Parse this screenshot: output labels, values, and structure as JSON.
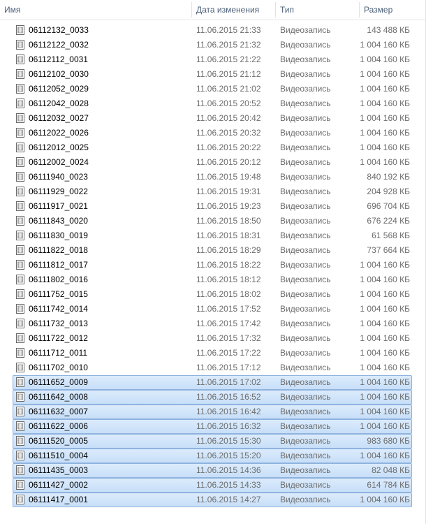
{
  "columns": {
    "name": "Имя",
    "date": "Дата изменения",
    "type": "Тип",
    "size": "Размер"
  },
  "icons": {
    "file": "video-file-icon"
  },
  "colors": {
    "header_text": "#4c607a",
    "selection_fill": "#cfe3fa",
    "selection_border": "#8fb3de",
    "secondary_text": "#6d6d6d"
  },
  "files": [
    {
      "name": "06112132_0033",
      "date": "11.06.2015 21:33",
      "type": "Видеозапись",
      "size": "143 488 КБ",
      "selected": false
    },
    {
      "name": "06112122_0032",
      "date": "11.06.2015 21:32",
      "type": "Видеозапись",
      "size": "1 004 160 КБ",
      "selected": false
    },
    {
      "name": "06112112_0031",
      "date": "11.06.2015 21:22",
      "type": "Видеозапись",
      "size": "1 004 160 КБ",
      "selected": false
    },
    {
      "name": "06112102_0030",
      "date": "11.06.2015 21:12",
      "type": "Видеозапись",
      "size": "1 004 160 КБ",
      "selected": false
    },
    {
      "name": "06112052_0029",
      "date": "11.06.2015 21:02",
      "type": "Видеозапись",
      "size": "1 004 160 КБ",
      "selected": false
    },
    {
      "name": "06112042_0028",
      "date": "11.06.2015 20:52",
      "type": "Видеозапись",
      "size": "1 004 160 КБ",
      "selected": false
    },
    {
      "name": "06112032_0027",
      "date": "11.06.2015 20:42",
      "type": "Видеозапись",
      "size": "1 004 160 КБ",
      "selected": false
    },
    {
      "name": "06112022_0026",
      "date": "11.06.2015 20:32",
      "type": "Видеозапись",
      "size": "1 004 160 КБ",
      "selected": false
    },
    {
      "name": "06112012_0025",
      "date": "11.06.2015 20:22",
      "type": "Видеозапись",
      "size": "1 004 160 КБ",
      "selected": false
    },
    {
      "name": "06112002_0024",
      "date": "11.06.2015 20:12",
      "type": "Видеозапись",
      "size": "1 004 160 КБ",
      "selected": false
    },
    {
      "name": "06111940_0023",
      "date": "11.06.2015 19:48",
      "type": "Видеозапись",
      "size": "840 192 КБ",
      "selected": false
    },
    {
      "name": "06111929_0022",
      "date": "11.06.2015 19:31",
      "type": "Видеозапись",
      "size": "204 928 КБ",
      "selected": false
    },
    {
      "name": "06111917_0021",
      "date": "11.06.2015 19:23",
      "type": "Видеозапись",
      "size": "696 704 КБ",
      "selected": false
    },
    {
      "name": "06111843_0020",
      "date": "11.06.2015 18:50",
      "type": "Видеозапись",
      "size": "676 224 КБ",
      "selected": false
    },
    {
      "name": "06111830_0019",
      "date": "11.06.2015 18:31",
      "type": "Видеозапись",
      "size": "61 568 КБ",
      "selected": false
    },
    {
      "name": "06111822_0018",
      "date": "11.06.2015 18:29",
      "type": "Видеозапись",
      "size": "737 664 КБ",
      "selected": false
    },
    {
      "name": "06111812_0017",
      "date": "11.06.2015 18:22",
      "type": "Видеозапись",
      "size": "1 004 160 КБ",
      "selected": false
    },
    {
      "name": "06111802_0016",
      "date": "11.06.2015 18:12",
      "type": "Видеозапись",
      "size": "1 004 160 КБ",
      "selected": false
    },
    {
      "name": "06111752_0015",
      "date": "11.06.2015 18:02",
      "type": "Видеозапись",
      "size": "1 004 160 КБ",
      "selected": false
    },
    {
      "name": "06111742_0014",
      "date": "11.06.2015 17:52",
      "type": "Видеозапись",
      "size": "1 004 160 КБ",
      "selected": false
    },
    {
      "name": "06111732_0013",
      "date": "11.06.2015 17:42",
      "type": "Видеозапись",
      "size": "1 004 160 КБ",
      "selected": false
    },
    {
      "name": "06111722_0012",
      "date": "11.06.2015 17:32",
      "type": "Видеозапись",
      "size": "1 004 160 КБ",
      "selected": false
    },
    {
      "name": "06111712_0011",
      "date": "11.06.2015 17:22",
      "type": "Видеозапись",
      "size": "1 004 160 КБ",
      "selected": false
    },
    {
      "name": "06111702_0010",
      "date": "11.06.2015 17:12",
      "type": "Видеозапись",
      "size": "1 004 160 КБ",
      "selected": false
    },
    {
      "name": "06111652_0009",
      "date": "11.06.2015 17:02",
      "type": "Видеозапись",
      "size": "1 004 160 КБ",
      "selected": true
    },
    {
      "name": "06111642_0008",
      "date": "11.06.2015 16:52",
      "type": "Видеозапись",
      "size": "1 004 160 КБ",
      "selected": true
    },
    {
      "name": "06111632_0007",
      "date": "11.06.2015 16:42",
      "type": "Видеозапись",
      "size": "1 004 160 КБ",
      "selected": true
    },
    {
      "name": "06111622_0006",
      "date": "11.06.2015 16:32",
      "type": "Видеозапись",
      "size": "1 004 160 КБ",
      "selected": true
    },
    {
      "name": "06111520_0005",
      "date": "11.06.2015 15:30",
      "type": "Видеозапись",
      "size": "983 680 КБ",
      "selected": true
    },
    {
      "name": "06111510_0004",
      "date": "11.06.2015 15:20",
      "type": "Видеозапись",
      "size": "1 004 160 КБ",
      "selected": true
    },
    {
      "name": "06111435_0003",
      "date": "11.06.2015 14:36",
      "type": "Видеозапись",
      "size": "82 048 КБ",
      "selected": true
    },
    {
      "name": "06111427_0002",
      "date": "11.06.2015 14:33",
      "type": "Видеозапись",
      "size": "614 784 КБ",
      "selected": true
    },
    {
      "name": "06111417_0001",
      "date": "11.06.2015 14:27",
      "type": "Видеозапись",
      "size": "1 004 160 КБ",
      "selected": true
    }
  ]
}
